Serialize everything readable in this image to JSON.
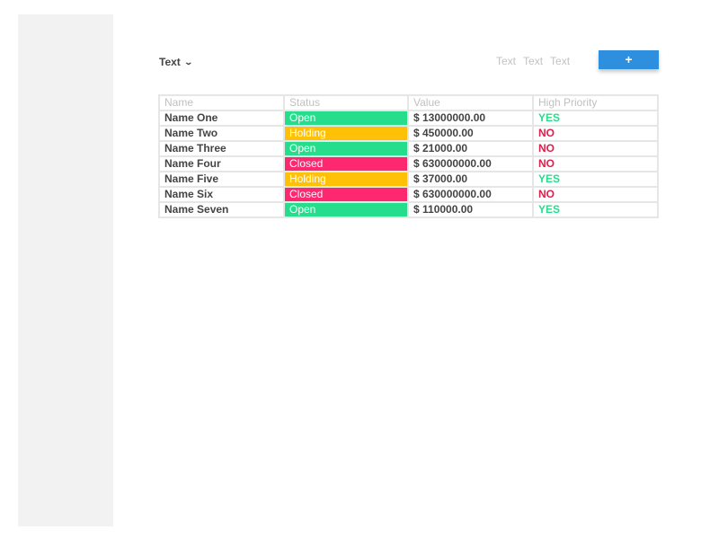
{
  "toolbar": {
    "dropdown_label": "Text",
    "links": [
      "Text",
      "Text",
      "Text"
    ],
    "add_button_label": "+"
  },
  "colors": {
    "accent": "#2d8fdd",
    "open": "#26dd8c",
    "holding": "#ffc107",
    "closed": "#fe2870",
    "yes": "#27dd8c",
    "no": "#dd1f4a"
  },
  "table": {
    "headers": [
      "Name",
      "Status",
      "Value",
      "High Priority"
    ],
    "rows": [
      {
        "name": "Name One",
        "status": "Open",
        "value": "$ 13000000.00",
        "priority": "YES"
      },
      {
        "name": "Name Two",
        "status": "Holding",
        "value": "$ 450000.00",
        "priority": "NO"
      },
      {
        "name": "Name Three",
        "status": "Open",
        "value": "$ 21000.00",
        "priority": "NO"
      },
      {
        "name": "Name Four",
        "status": "Closed",
        "value": "$ 630000000.00",
        "priority": "NO"
      },
      {
        "name": "Name Five",
        "status": "Holding",
        "value": "$ 37000.00",
        "priority": "YES"
      },
      {
        "name": "Name Six",
        "status": "Closed",
        "value": "$ 630000000.00",
        "priority": "NO"
      },
      {
        "name": "Name Seven",
        "status": "Open",
        "value": "$ 110000.00",
        "priority": "YES"
      }
    ]
  }
}
